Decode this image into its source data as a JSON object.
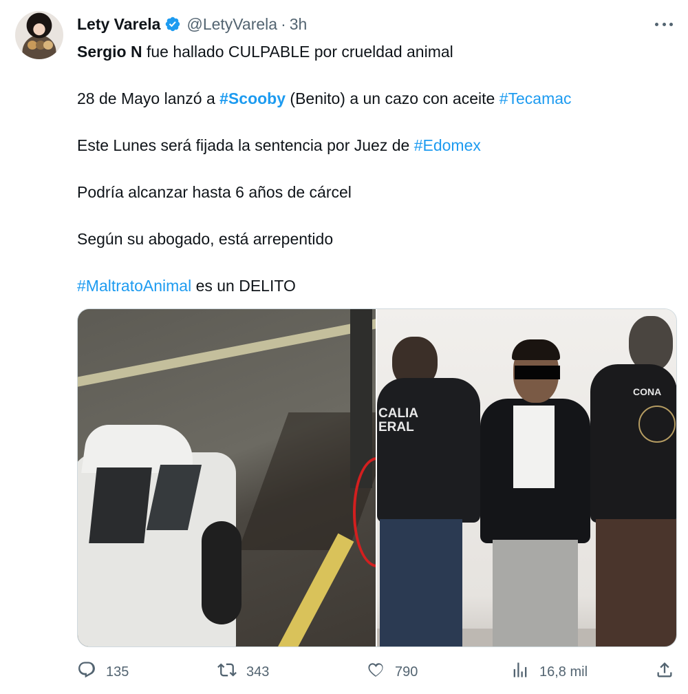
{
  "author": {
    "name": "Lety Varela",
    "handle": "@LetyVarela",
    "separator": "·",
    "time": "3h"
  },
  "tweet": {
    "line1_bold": "Sergio N",
    "line1_rest": " fue hallado CULPABLE por crueldad animal",
    "line2_a": "28 de Mayo lanzó a ",
    "line2_tag1": "#Scooby",
    "line2_b": " (Benito) a un cazo con aceite ",
    "line2_tag2": "#Tecamac",
    "line3_a": "Este Lunes será fijada la sentencia por Juez de ",
    "line3_tag": "#Edomex",
    "line4": "Podría alcanzar hasta 6 años de cárcel",
    "line5": "Según su abogado, está arrepentido",
    "line6_tag": "#MaltratoAnimal",
    "line6_rest": " es un DELITO"
  },
  "media": {
    "image_right_text_left": "CALIA\nERAL",
    "image_right_text_right": "CONA"
  },
  "actions": {
    "replies": "135",
    "reposts": "343",
    "likes": "790",
    "views": "16,8 mil"
  },
  "colors": {
    "accent": "#1d9bf0",
    "muted": "#536471"
  },
  "icons": [
    "verified-badge-icon",
    "more-icon",
    "reply-icon",
    "repost-icon",
    "like-icon",
    "views-icon",
    "share-icon"
  ]
}
